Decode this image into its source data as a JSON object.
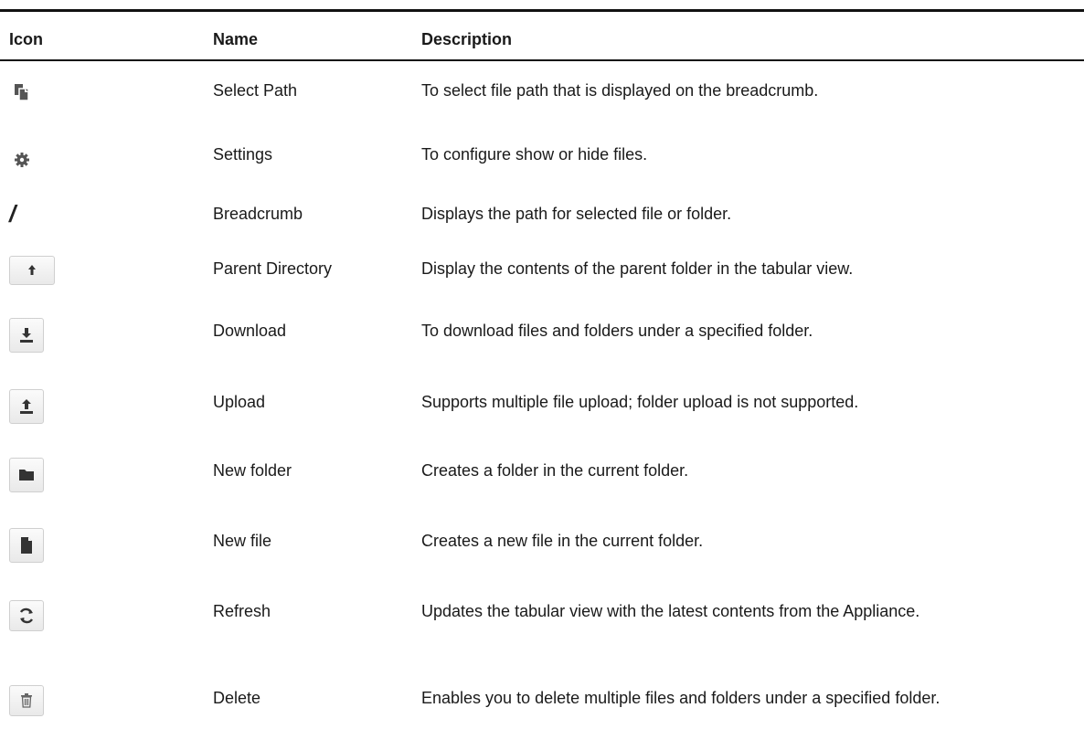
{
  "table": {
    "headers": {
      "icon": "Icon",
      "name": "Name",
      "description": "Description"
    },
    "rows": [
      {
        "icon": "copy-path-icon",
        "name": "Select Path",
        "description": "To select file path that is displayed on the breadcrumb."
      },
      {
        "icon": "gear-icon",
        "name": "Settings",
        "description": "To configure show or hide files."
      },
      {
        "icon": "slash-icon",
        "name": "Breadcrumb",
        "description": "Displays the path for selected file or folder.",
        "glyph": "/"
      },
      {
        "icon": "parent-directory-icon",
        "name": "Parent Directory",
        "description": "Display the contents of the parent folder in the tabular view."
      },
      {
        "icon": "download-icon",
        "name": "Download",
        "description": "To download files and folders under a specified folder."
      },
      {
        "icon": "upload-icon",
        "name": "Upload",
        "description": "Supports multiple file upload; folder upload is not supported."
      },
      {
        "icon": "folder-icon",
        "name": "New folder",
        "description": "Creates a folder in the current folder."
      },
      {
        "icon": "file-icon",
        "name": "New file",
        "description": "Creates a new file in the current folder."
      },
      {
        "icon": "refresh-icon",
        "name": "Refresh",
        "description": "Updates the tabular view with the latest contents from the Appliance."
      },
      {
        "icon": "trash-icon",
        "name": "Delete",
        "description": "Enables you to delete multiple files and folders under a specified folder."
      }
    ]
  },
  "colors": {
    "rule": "#111111",
    "icon_fill": "#333333",
    "button_border": "#cfcfcf"
  }
}
